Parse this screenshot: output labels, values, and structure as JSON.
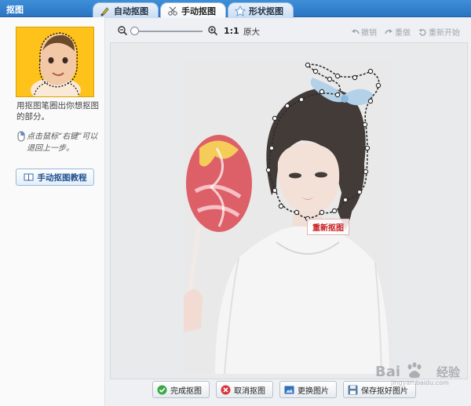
{
  "window": {
    "title": "抠图"
  },
  "tabs": [
    {
      "label": "自动抠图",
      "icon": "brush-icon",
      "active": false
    },
    {
      "label": "手动抠图",
      "icon": "scissors-icon",
      "active": true
    },
    {
      "label": "形状抠图",
      "icon": "shape-icon",
      "active": false
    }
  ],
  "sidebar": {
    "tip": "用抠图笔圈出你想抠图的部分。",
    "mouse_tip": "点击鼠标“右键”可以退回上一步。",
    "tutorial_label": "手动抠图教程"
  },
  "toolbar": {
    "ratio": "1:1",
    "original": "原大",
    "undo": "撤销",
    "redo": "重做",
    "restart": "重新开始",
    "zoom_level": 0.0
  },
  "canvas": {
    "recut_label": "重新抠图"
  },
  "actions": {
    "done": "完成抠图",
    "cancel": "取消抠图",
    "change": "更换图片",
    "save": "保存抠好图片"
  },
  "watermark": {
    "brand": "Bai",
    "site": "经验",
    "url": "jingyan.baidu.com"
  },
  "colors": {
    "title_bar": "#2b74c2",
    "accent_red": "#c81b1b",
    "lasso": "#222222"
  }
}
